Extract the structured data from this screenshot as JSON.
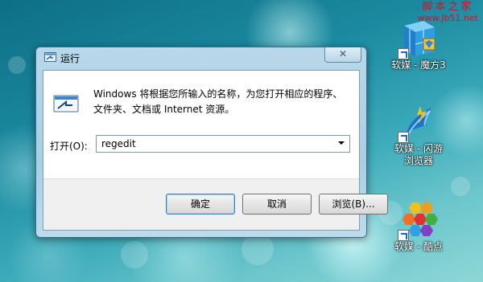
{
  "watermark": {
    "line1": "脚本之家",
    "line2": "www.Jb51.net"
  },
  "desktop_icons": [
    {
      "label_line1": "软媒 - 魔方3",
      "label_line2": ""
    },
    {
      "label_line1": "软媒 - 闪游",
      "label_line2": "浏览器"
    },
    {
      "label_line1": "软媒 - 酷点",
      "label_line2": ""
    }
  ],
  "dialog": {
    "title": "运行",
    "close_symbol": "✕",
    "description_line1": "Windows 将根据您所输入的名称，为您打开相应的程序、",
    "description_line2": "文件夹、文档或 Internet 资源。",
    "open_label": "打开(O):",
    "open_value": "regedit",
    "buttons": {
      "ok": "确定",
      "cancel": "取消",
      "browse": "浏览(B)..."
    }
  }
}
